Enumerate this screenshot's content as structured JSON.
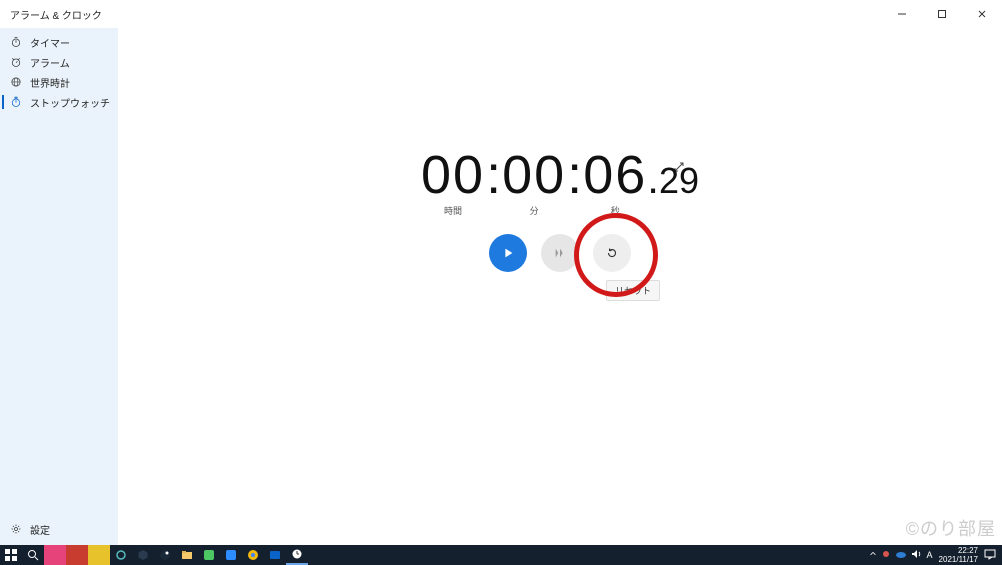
{
  "window": {
    "title": "アラーム & クロック",
    "minimize": "—",
    "maximize": "▢",
    "close": "✕"
  },
  "sidebar": {
    "items": [
      {
        "label": "タイマー"
      },
      {
        "label": "アラーム"
      },
      {
        "label": "世界時計"
      },
      {
        "label": "ストップウォッチ"
      }
    ],
    "settings": "設定"
  },
  "stopwatch": {
    "hours": "00",
    "minutes": "00",
    "seconds": "06",
    "fraction": "29",
    "labels": {
      "hours": "時間",
      "minutes": "分",
      "seconds": "秒"
    },
    "tooltip": "リセット"
  },
  "taskbar": {
    "time": "22:27",
    "date": "2021/11/17",
    "ime": "A"
  },
  "watermark": "©のり部屋"
}
